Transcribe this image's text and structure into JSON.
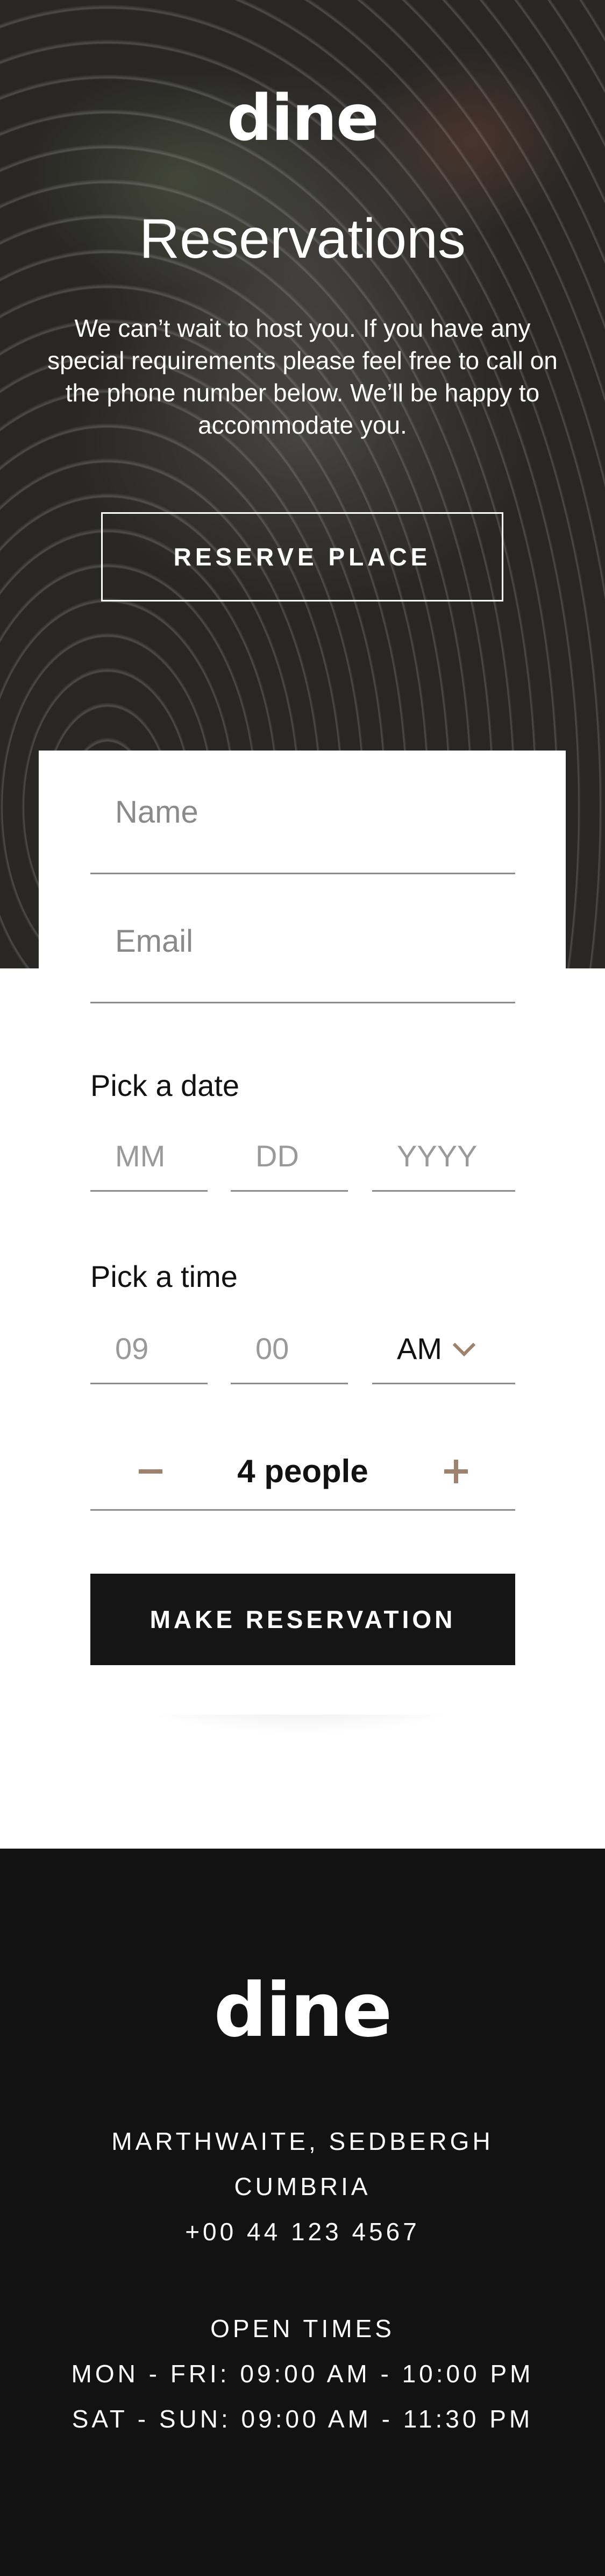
{
  "hero": {
    "logo": "dine",
    "title": "Reservations",
    "text": "We can’t wait to host you. If you have any special requirements please feel free to call on the phone number below. We’ll be happy to accommodate you.",
    "reserve_button": "RESERVE PLACE",
    "background_image": "plate-of-food-photo"
  },
  "form": {
    "name_placeholder": "Name",
    "email_placeholder": "Email",
    "date_label": "Pick a date",
    "date_month_placeholder": "MM",
    "date_day_placeholder": "DD",
    "date_year_placeholder": "YYYY",
    "time_label": "Pick a time",
    "time_hour_placeholder": "09",
    "time_minute_placeholder": "00",
    "time_period": "AM",
    "people_count": "4 people",
    "make_reservation_button": "MAKE RESERVATION"
  },
  "footer": {
    "logo": "dine",
    "address_line1": "MARTHWAITE, SEDBERGH",
    "address_line2": "CUMBRIA",
    "phone": "+00 44 123 4567",
    "open_times_label": "OPEN TIMES",
    "weekday_hours": "MON - FRI: 09:00 AM - 10:00 PM",
    "weekend_hours": "SAT - SUN: 09:00 AM - 11:30 PM"
  },
  "colors": {
    "accent": "#9d8270",
    "dark": "#121212",
    "button": "#151515",
    "white": "#ffffff"
  }
}
